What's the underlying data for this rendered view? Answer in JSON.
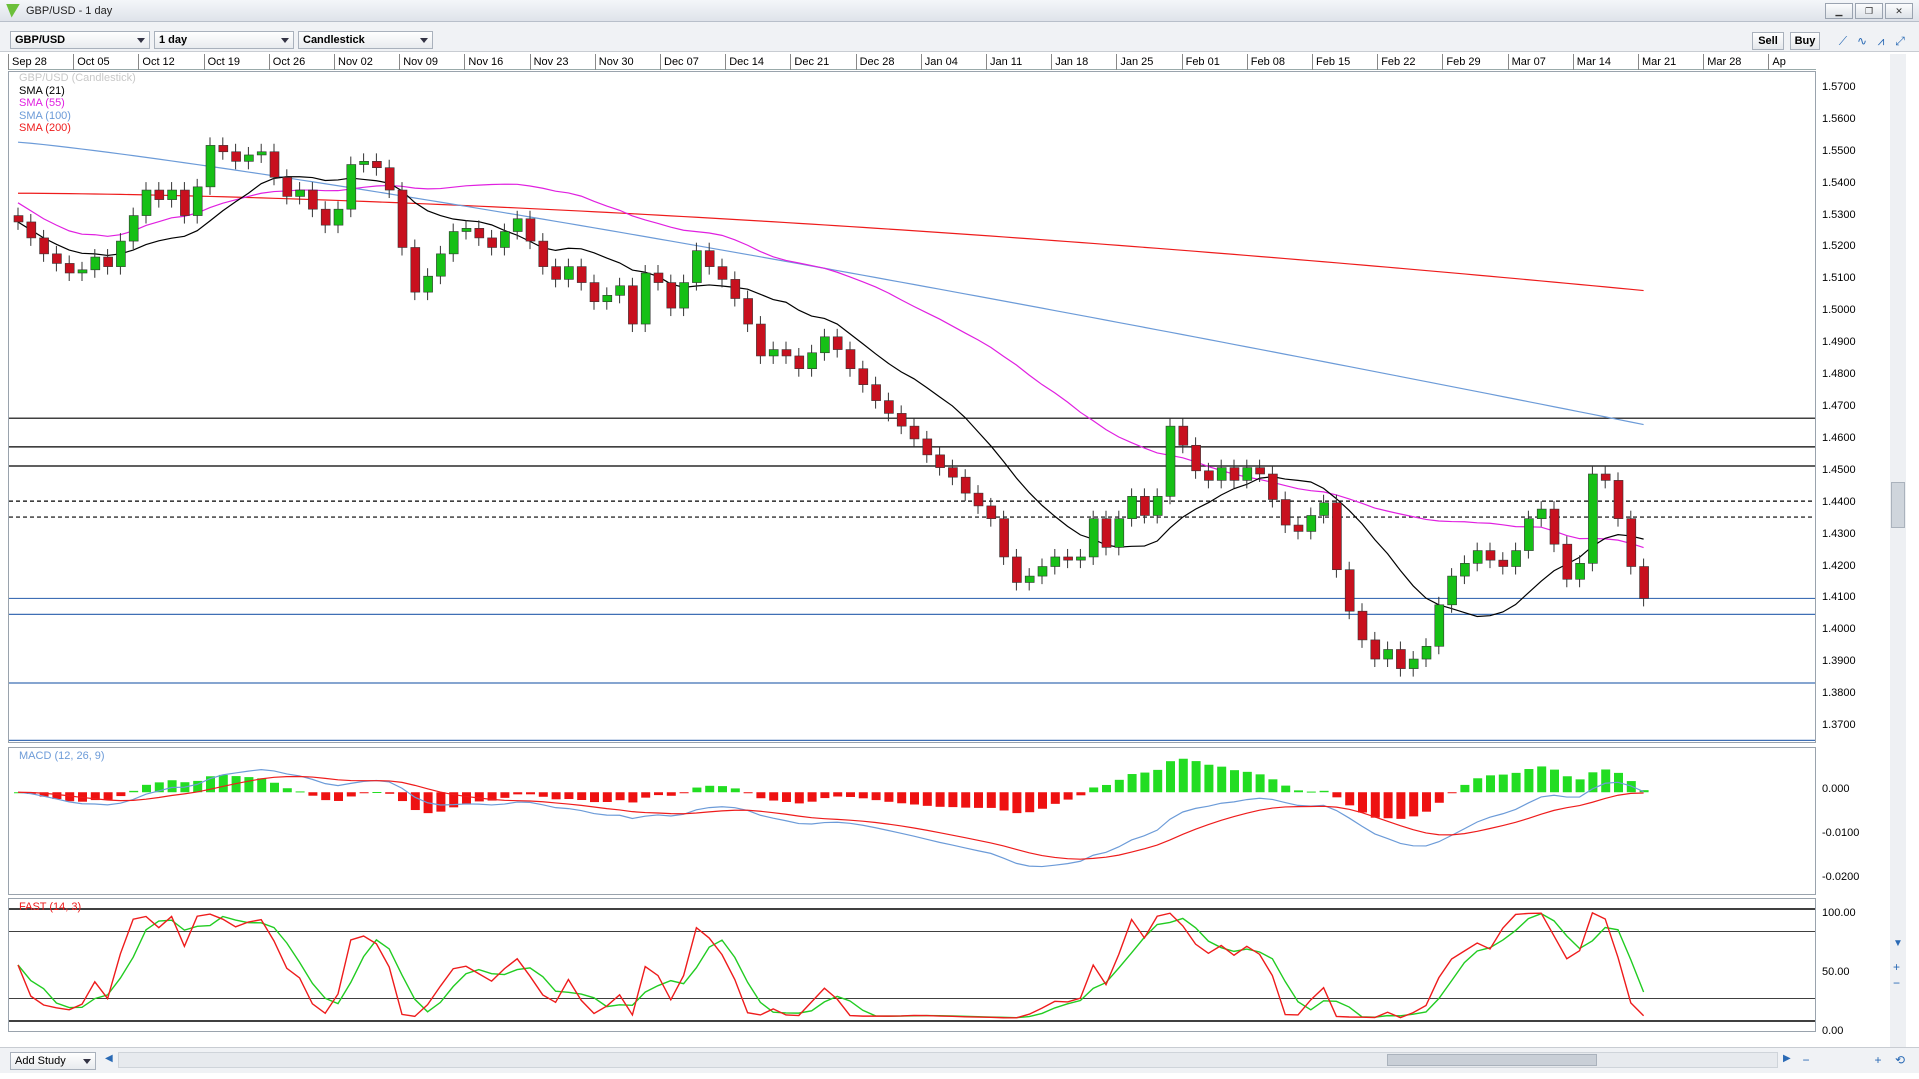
{
  "window": {
    "title": "GBP/USD - 1 day",
    "controls": [
      "▁",
      "❐",
      "✕"
    ]
  },
  "toolbar": {
    "instrument": "GBP/USD",
    "timeframe": "1 day",
    "chart_style": "Candlestick",
    "sell_label": "Sell",
    "buy_label": "Buy"
  },
  "dates": [
    "Sep 28",
    "Oct 05",
    "Oct 12",
    "Oct 19",
    "Oct 26",
    "Nov 02",
    "Nov 09",
    "Nov 16",
    "Nov 23",
    "Nov 30",
    "Dec 07",
    "Dec 14",
    "Dec 21",
    "Dec 28",
    "Jan 04",
    "Jan 11",
    "Jan 18",
    "Jan 25",
    "Feb 01",
    "Feb 08",
    "Feb 15",
    "Feb 22",
    "Feb 29",
    "Mar 07",
    "Mar 14",
    "Mar 21",
    "Mar 28",
    "Ap"
  ],
  "price_legend": [
    {
      "text": "GBP/USD (Candlestick)",
      "color": "#c8c8c8"
    },
    {
      "text": "SMA (21)",
      "color": "#000000"
    },
    {
      "text": "SMA (55)",
      "color": "#e020e0"
    },
    {
      "text": "SMA (100)",
      "color": "#6c9bd8"
    },
    {
      "text": "SMA (200)",
      "color": "#ee1c1c"
    }
  ],
  "price_axis": [
    "1.5700",
    "1.5600",
    "1.5500",
    "1.5400",
    "1.5300",
    "1.5200",
    "1.5100",
    "1.5000",
    "1.4900",
    "1.4800",
    "1.4700",
    "1.4600",
    "1.4500",
    "1.4400",
    "1.4300",
    "1.4200",
    "1.4100",
    "1.4000",
    "1.3900",
    "1.3800",
    "1.3700"
  ],
  "macd_legend": {
    "text": "MACD (12, 26, 9)",
    "color": "#6c9bd8"
  },
  "macd_axis": [
    "0.000",
    "-0.0100",
    "-0.0200"
  ],
  "fast_legend": {
    "text": "FAST (14, 3)",
    "color": "#ee1c1c"
  },
  "fast_axis": [
    "100.00",
    "50.00",
    "0.00"
  ],
  "bottom": {
    "add_study": "Add Study"
  },
  "chart_data": {
    "type": "candlestick",
    "title": "GBP/USD - 1 day",
    "ylim": [
      1.365,
      1.575
    ],
    "horizontal_lines": [
      1.4665,
      1.4575,
      1.4515,
      1.4405,
      1.4355,
      1.41,
      1.405,
      1.3835,
      1.3655
    ],
    "closes": [
      1.528,
      1.523,
      1.518,
      1.515,
      1.512,
      1.513,
      1.517,
      1.514,
      1.522,
      1.53,
      1.538,
      1.535,
      1.538,
      1.53,
      1.539,
      1.552,
      1.55,
      1.547,
      1.549,
      1.55,
      1.542,
      1.536,
      1.538,
      1.532,
      1.527,
      1.532,
      1.546,
      1.547,
      1.545,
      1.538,
      1.52,
      1.506,
      1.511,
      1.518,
      1.525,
      1.526,
      1.523,
      1.52,
      1.525,
      1.529,
      1.522,
      1.514,
      1.51,
      1.514,
      1.509,
      1.503,
      1.505,
      1.508,
      1.496,
      1.512,
      1.509,
      1.501,
      1.509,
      1.519,
      1.514,
      1.51,
      1.504,
      1.496,
      1.486,
      1.488,
      1.486,
      1.482,
      1.487,
      1.492,
      1.488,
      1.482,
      1.477,
      1.472,
      1.468,
      1.464,
      1.46,
      1.455,
      1.451,
      1.448,
      1.443,
      1.439,
      1.435,
      1.423,
      1.415,
      1.417,
      1.42,
      1.423,
      1.422,
      1.423,
      1.435,
      1.426,
      1.435,
      1.442,
      1.436,
      1.442,
      1.464,
      1.458,
      1.45,
      1.447,
      1.451,
      1.447,
      1.451,
      1.449,
      1.441,
      1.433,
      1.431,
      1.436,
      1.44,
      1.419,
      1.406,
      1.397,
      1.391,
      1.394,
      1.388,
      1.391,
      1.395,
      1.408,
      1.417,
      1.421,
      1.425,
      1.422,
      1.42,
      1.425,
      1.435,
      1.438,
      1.427,
      1.416,
      1.421,
      1.449,
      1.447,
      1.435,
      1.42,
      1.41
    ],
    "sma21_last": 1.4185,
    "sma55_last": 1.43,
    "sma100_last": 1.4645,
    "sma200_last": 1.5065,
    "macd_ylim": [
      -0.023,
      0.01
    ],
    "fast_ylim": [
      0,
      100
    ],
    "fast_levels": [
      100,
      80,
      20,
      0
    ]
  }
}
